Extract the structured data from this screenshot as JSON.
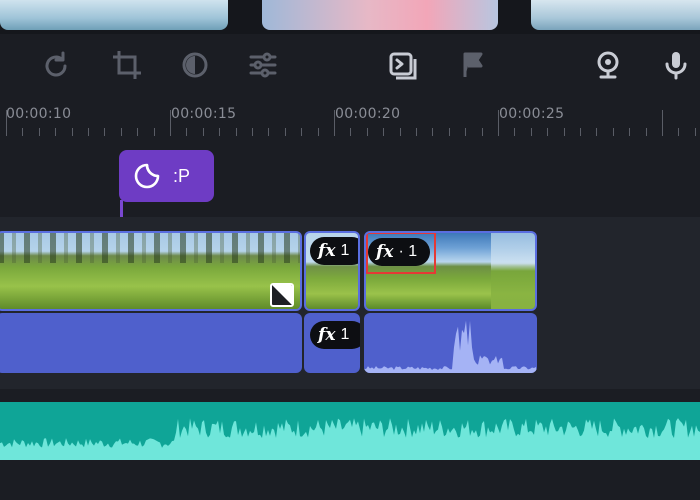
{
  "ruler": {
    "labels": [
      "00:00:10",
      "00:00:15",
      "00:00:20",
      "00:00:25"
    ]
  },
  "toolbar": {
    "icons": [
      "redo-icon",
      "crop-icon",
      "color-adjust-icon",
      "sliders-icon",
      "clip-properties-icon",
      "flag-icon",
      "webcam-icon",
      "microphone-icon"
    ]
  },
  "sticker": {
    "label": ":P"
  },
  "video_clips": {
    "clip2_fx_count": "1",
    "clip3_fx_count": "1"
  },
  "audio_clips": {
    "clip2_fx_count": "1"
  },
  "colors": {
    "background": "#1b1d23",
    "video_clip": "#4a60d2",
    "sticker": "#6e3cc4",
    "music": "#0fa597",
    "highlight": "#e53935"
  }
}
